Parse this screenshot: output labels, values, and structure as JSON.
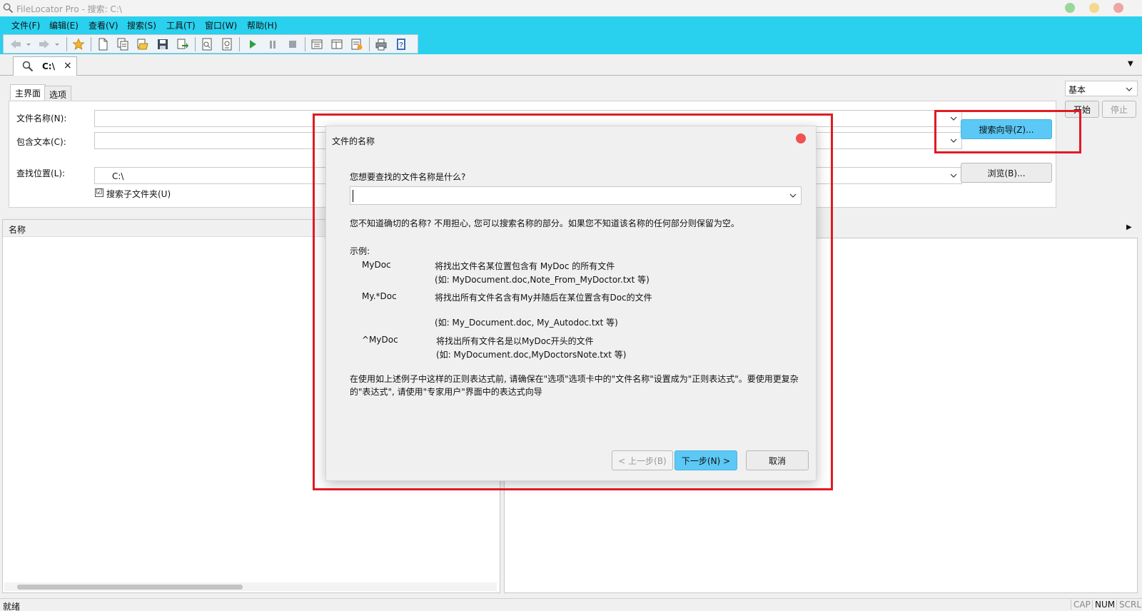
{
  "window": {
    "title": "FileLocator Pro - 搜索: C:\\"
  },
  "menu": [
    "文件(F)",
    "编辑(E)",
    "查看(V)",
    "搜索(S)",
    "工具(T)",
    "窗口(W)",
    "帮助(H)"
  ],
  "tab": {
    "label": "C:\\",
    "close": "×"
  },
  "subtabs": {
    "main": "主界面",
    "options": "选项"
  },
  "form": {
    "filename_label": "文件名称(N):",
    "containing_label": "包含文本(C):",
    "lookin_label": "查找位置(L):",
    "lookin_value": "C:\\",
    "subfolders_label": "搜索子文件夹(U)",
    "subfolders_checked": "☑",
    "wizard_button": "搜索向导(Z)...",
    "browse_button": "浏览(B)..."
  },
  "mode": {
    "value": "基本",
    "start": "开始",
    "stop": "停止"
  },
  "results": {
    "name_header": "名称",
    "expand_arrow": "▶"
  },
  "status": {
    "ready": "就绪",
    "cap": "CAP",
    "num": "NUM",
    "scrl": "SCRL"
  },
  "dialog": {
    "title": "文件的名称",
    "question": "您想要查找的文件名称是什么?",
    "hint": "您不知道确切的名称? 不用担心, 您可以搜索名称的部分。如果您不知道该名称的任何部分则保留为空。",
    "examples_label": "示例:",
    "examples": [
      {
        "pattern": "MyDoc",
        "desc": "将找出文件名某位置包含有 MyDoc 的所有文件",
        "sample": "(如: MyDocument.doc,Note_From_MyDoctor.txt 等)"
      },
      {
        "pattern": "My.*Doc",
        "desc": "将找出所有文件名含有My并随后在某位置含有Doc的文件",
        "sample": "(如: My_Document.doc, My_Autodoc.txt 等)"
      },
      {
        "pattern": "^MyDoc",
        "desc": "将找出所有文件名是以MyDoc开头的文件",
        "sample": "(如: MyDocument.doc,MyDoctorsNote.txt 等)"
      }
    ],
    "note_line1": "在使用如上述例子中这样的正则表达式前, 请确保在\"选项\"选项卡中的\"文件名称\"设置成为\"正则表达式\"。要使用更复杂",
    "note_line2": "的\"表达式\", 请使用\"专家用户\"界面中的表达式向导",
    "back_button": "< 上一步(B)",
    "next_button": "下一步(N) >",
    "cancel_button": "取消"
  },
  "colors": {
    "accent": "#29d1ee",
    "primary_button": "#5bc8f5",
    "highlight": "#e01b24"
  }
}
